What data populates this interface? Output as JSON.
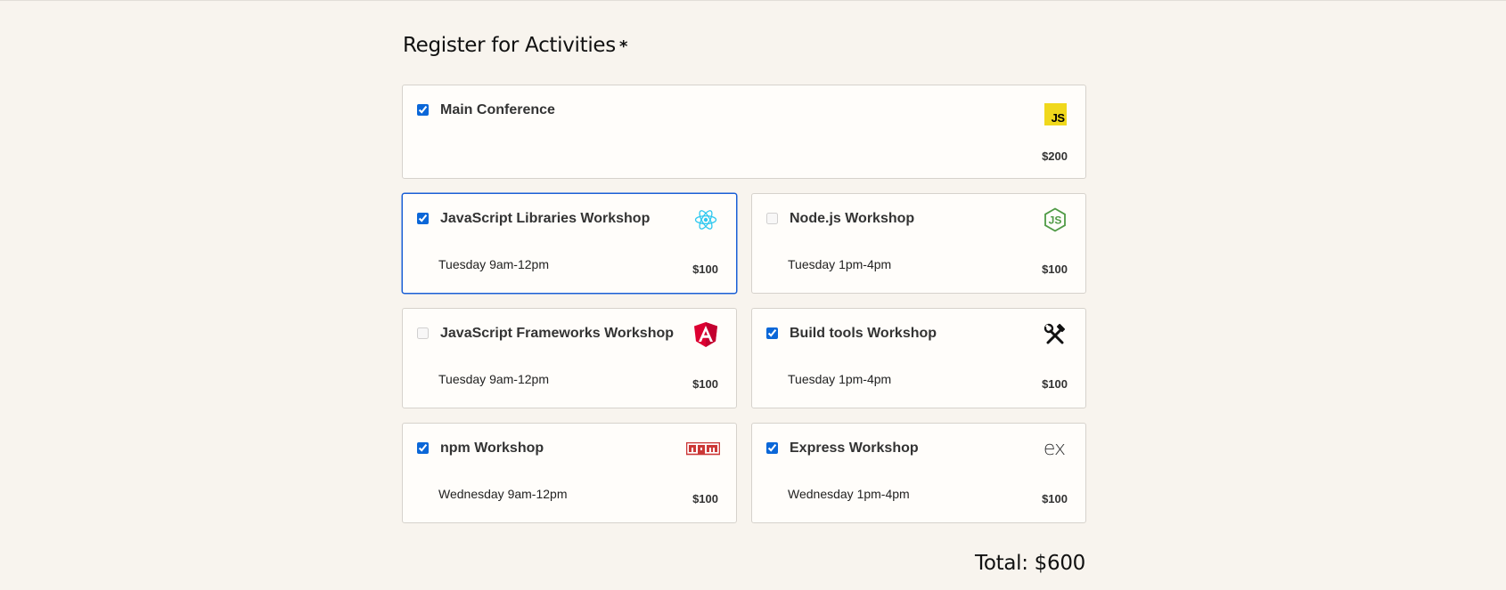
{
  "section": {
    "title": "Register for Activities",
    "required_marker": "*"
  },
  "activities": [
    {
      "name": "Main Conference",
      "time": "",
      "price": "$200",
      "checked": true,
      "logo_icon": "javascript-logo-icon",
      "logo_text": "JS"
    },
    {
      "name": "JavaScript Libraries Workshop",
      "time": "Tuesday 9am-12pm",
      "price": "$100",
      "checked": true,
      "logo_icon": "react-logo-icon"
    },
    {
      "name": "Node.js Workshop",
      "time": "Tuesday 1pm-4pm",
      "price": "$100",
      "checked": false,
      "logo_icon": "nodejs-logo-icon"
    },
    {
      "name": "JavaScript Frameworks Workshop",
      "time": "Tuesday 9am-12pm",
      "price": "$100",
      "checked": false,
      "logo_icon": "angular-logo-icon"
    },
    {
      "name": "Build tools Workshop",
      "time": "Tuesday 1pm-4pm",
      "price": "$100",
      "checked": true,
      "logo_icon": "hammer-wrench-icon"
    },
    {
      "name": "npm Workshop",
      "time": "Wednesday 9am-12pm",
      "price": "$100",
      "checked": true,
      "logo_icon": "npm-logo-icon",
      "logo_text": "npm"
    },
    {
      "name": "Express Workshop",
      "time": "Wednesday 1pm-4pm",
      "price": "$100",
      "checked": true,
      "logo_icon": "express-logo-icon",
      "logo_text": "ex"
    }
  ],
  "total": {
    "label": "Total: $600"
  },
  "colors": {
    "background": "#f8f4ee",
    "card": "#fffdfa",
    "focus_border": "#1a5fd6",
    "checkbox": "#0b67d8",
    "js_yellow": "#f0d81c",
    "react_cyan": "#2ec8f0",
    "node_green": "#4f9a45",
    "angular_red": "#dd0031",
    "npm_red": "#cb3837"
  }
}
